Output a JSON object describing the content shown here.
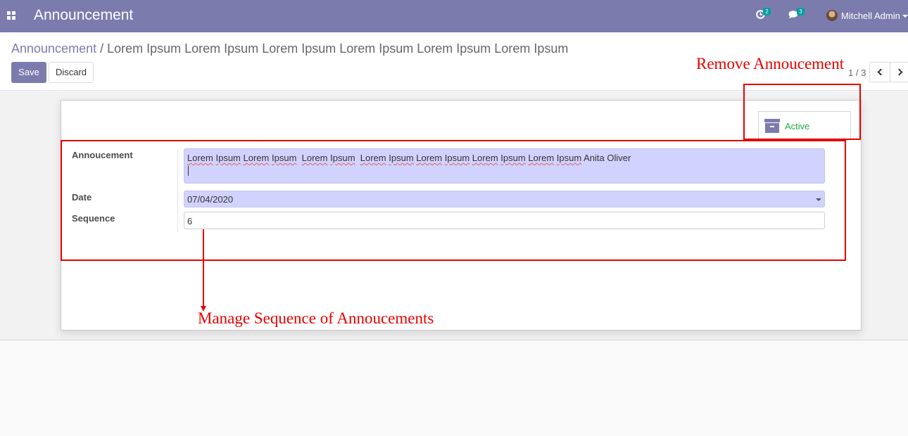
{
  "navbar": {
    "app_title": "Announcement",
    "activity_count": "2",
    "messages_count": "3",
    "user_name": "Mitchell Admin",
    "background_color": "#7c7bad"
  },
  "breadcrumb": {
    "parent": "Announcement",
    "separator": " / ",
    "current": "Lorem Ipsum Lorem Ipsum Lorem Ipsum Lorem Ipsum Lorem Ipsum Lorem Ipsum"
  },
  "toolbar": {
    "save_label": "Save",
    "discard_label": "Discard"
  },
  "pager": {
    "value": "1 / 3"
  },
  "smart_button": {
    "active_label": "Active",
    "icon": "archive-icon"
  },
  "form": {
    "announcement_label": "Annoucement",
    "announcement_words": [
      "Lorem",
      "Ipsum",
      "Lorem",
      "Ipsum",
      "Lorem",
      "Ipsum",
      "Lorem",
      "Ipsum",
      "Lorem",
      "Ipsum",
      "Lorem",
      "Ipsum",
      "Lorem",
      "Ipsum"
    ],
    "announcement_tail": "Anita Oliver",
    "date_label": "Date",
    "date_value": "07/04/2020",
    "sequence_label": "Sequence",
    "sequence_value": "6"
  },
  "annotations": {
    "remove": "Remove Annoucement",
    "sequence": "Manage Sequence of Annoucements",
    "color": "#e60000"
  }
}
